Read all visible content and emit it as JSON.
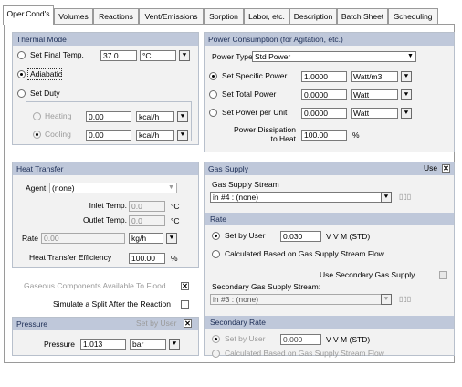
{
  "tabs": [
    "Oper.Cond's",
    "Volumes",
    "Reactions",
    "Vent/Emissions",
    "Sorption",
    "Labor, etc.",
    "Description",
    "Batch Sheet",
    "Scheduling"
  ],
  "thermal": {
    "title": "Thermal Mode",
    "final_temp_label": "Set Final Temp.",
    "final_temp_value": "37.0",
    "final_temp_unit": "°C",
    "adiabatic_label": "Adiabatic",
    "duty_label": "Set Duty",
    "heating_label": "Heating",
    "heating_value": "0.00",
    "heating_unit": "kcal/h",
    "cooling_label": "Cooling",
    "cooling_value": "0.00",
    "cooling_unit": "kcal/h"
  },
  "power": {
    "title": "Power Consumption (for Agitation, etc.)",
    "type_label": "Power Type",
    "type_value": "Std Power",
    "specific_label": "Set Specific Power",
    "specific_value": "1.0000",
    "specific_unit": "Watt/m3",
    "total_label": "Set Total Power",
    "total_value": "0.0000",
    "total_unit": "Watt",
    "per_unit_label": "Set Power per Unit",
    "per_unit_value": "0.0000",
    "per_unit_unit": "Watt",
    "dissipation_label_1": "Power Dissipation",
    "dissipation_label_2": "to Heat",
    "dissipation_value": "100.00",
    "dissipation_unit": "%"
  },
  "heat": {
    "title": "Heat Transfer",
    "agent_label": "Agent",
    "agent_value": "(none)",
    "inlet_label": "Inlet Temp.",
    "inlet_value": "0.0",
    "inlet_unit": "°C",
    "outlet_label": "Outlet Temp.",
    "outlet_value": "0.0",
    "outlet_unit": "°C",
    "rate_label": "Rate",
    "rate_value": "0.00",
    "rate_unit": "kg/h",
    "efficiency_label": "Heat Transfer Efficiency",
    "efficiency_value": "100.00",
    "efficiency_unit": "%"
  },
  "options": {
    "gaseous_label": "Gaseous Components Available To Flood",
    "split_label": "Simulate a Split After the Reaction"
  },
  "pressure": {
    "title": "Pressure",
    "set_by_user": "Set by User",
    "pressure_label": "Pressure",
    "pressure_value": "1.013",
    "pressure_unit": "bar"
  },
  "gas": {
    "title": "Gas Supply",
    "use_label": "Use",
    "stream_label": "Gas Supply Stream",
    "stream_value": "in #4 : (none)",
    "rate_title": "Rate",
    "set_by_user_label": "Set by User",
    "rate_value": "0.030",
    "rate_unit": "V V M (STD)",
    "calculated_label": "Calculated Based on Gas Supply Stream Flow",
    "secondary_use_label": "Use Secondary Gas Supply",
    "secondary_stream_label": "Secondary Gas Supply Stream:",
    "secondary_stream_value": "in #3 : (none)",
    "secondary_rate_title": "Secondary Rate",
    "secondary_set_by_user_label": "Set by User",
    "secondary_rate_value": "0.000",
    "secondary_rate_unit": "V V M (STD)",
    "secondary_calculated_label": "Calculated Based on Gas Supply Stream Flow"
  },
  "icons": {
    "dropdown": "chevron-down-icon",
    "stream_tools": "stream-tools-icon"
  }
}
